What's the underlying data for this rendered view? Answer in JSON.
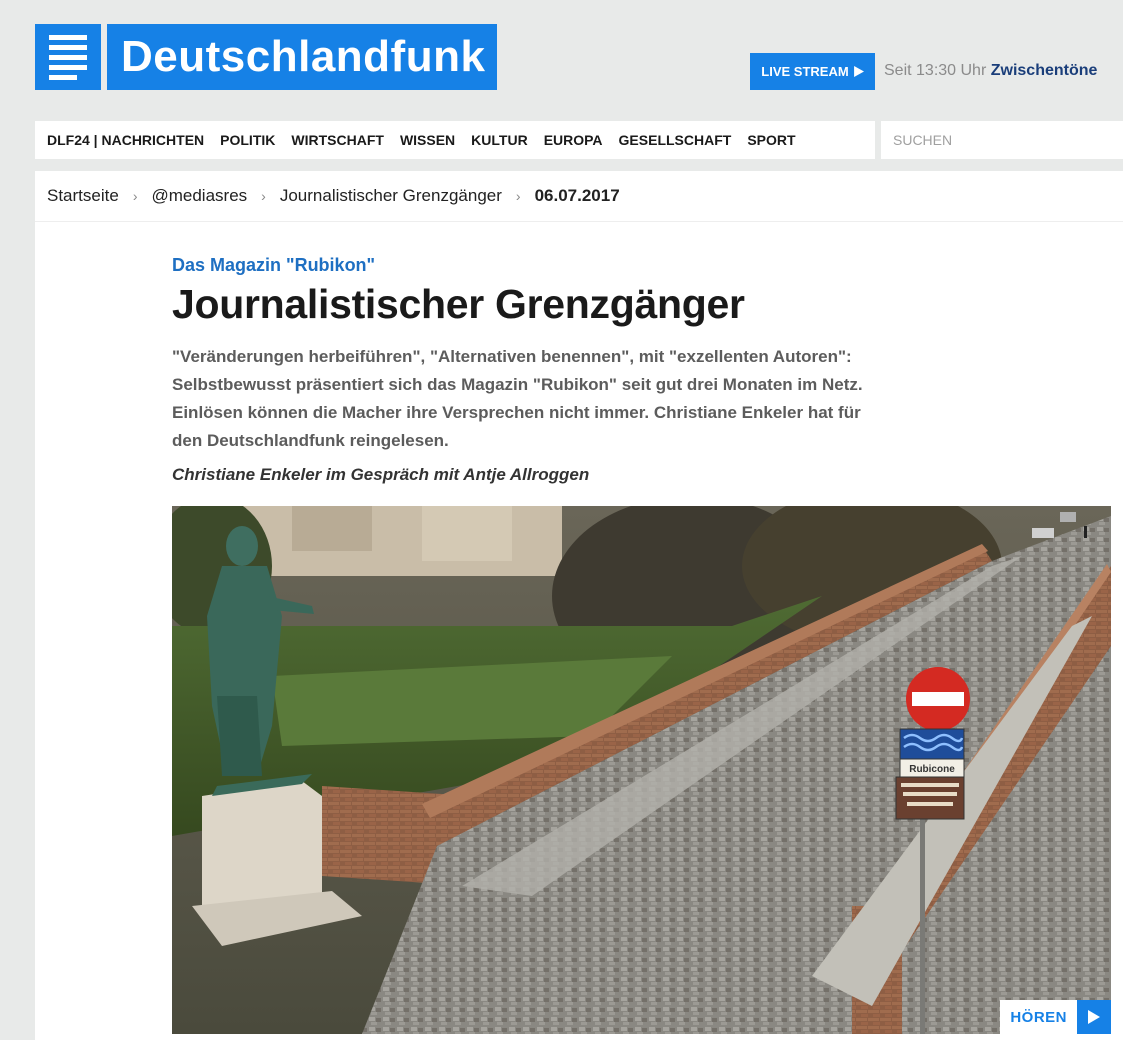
{
  "header": {
    "logo_text": "Deutschlandfunk",
    "live_stream_label": "LIVE STREAM",
    "live_since": "Seit 13:30 Uhr",
    "live_program": "Zwischentöne"
  },
  "nav": {
    "items": [
      "DLF24 | NACHRICHTEN",
      "POLITIK",
      "WIRTSCHAFT",
      "WISSEN",
      "KULTUR",
      "EUROPA",
      "GESELLSCHAFT",
      "SPORT"
    ]
  },
  "search": {
    "placeholder": "SUCHEN"
  },
  "breadcrumb": {
    "items": [
      "Startseite",
      "@mediasres",
      "Journalistischer Grenzgänger"
    ],
    "current": "06.07.2017",
    "separator": "›"
  },
  "article": {
    "kicker": "Das Magazin \"Rubikon\"",
    "title": "Journalistischer Grenzgänger",
    "teaser": "\"Veränderungen herbeiführen\", \"Alternativen benennen\", mit \"exzellenten Autoren\": Selbstbewusst präsentiert sich das Magazin \"Rubikon\" seit gut drei Monaten im Netz. Einlösen können die Macher ihre Versprechen nicht immer. Christiane Enkeler hat für den Deutschlandfunk reingelesen.",
    "byline": "Christiane Enkeler im Gespräch mit Antje Allroggen"
  },
  "image": {
    "sign_text": "Rubicone",
    "hoeren_label": "HÖREN"
  },
  "colors": {
    "brand_blue": "#1681e6",
    "kicker_blue": "#1e6fc2",
    "program_navy": "#1a3e7a",
    "page_bg": "#e8eae9"
  },
  "icons": [
    "logo-lines-icon",
    "play-triangle-icon",
    "chevron-right-icon",
    "play-icon"
  ]
}
